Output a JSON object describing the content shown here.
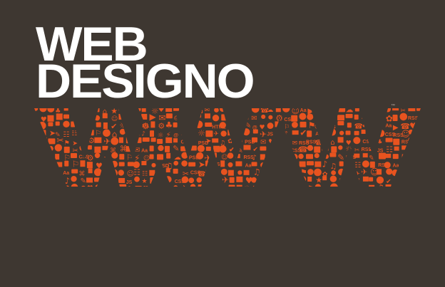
{
  "headline": {
    "line1": "WEB",
    "line2": "DESIGNO"
  },
  "artwork": {
    "letters": "WWW",
    "icon_labels": [
      "HTML",
      "CSS",
      "RSS",
      "Aa",
      "@",
      "PSD",
      "JS"
    ],
    "colors": {
      "background": "#3e3731",
      "text": "#ffffff",
      "accent": "#e8531f"
    }
  }
}
